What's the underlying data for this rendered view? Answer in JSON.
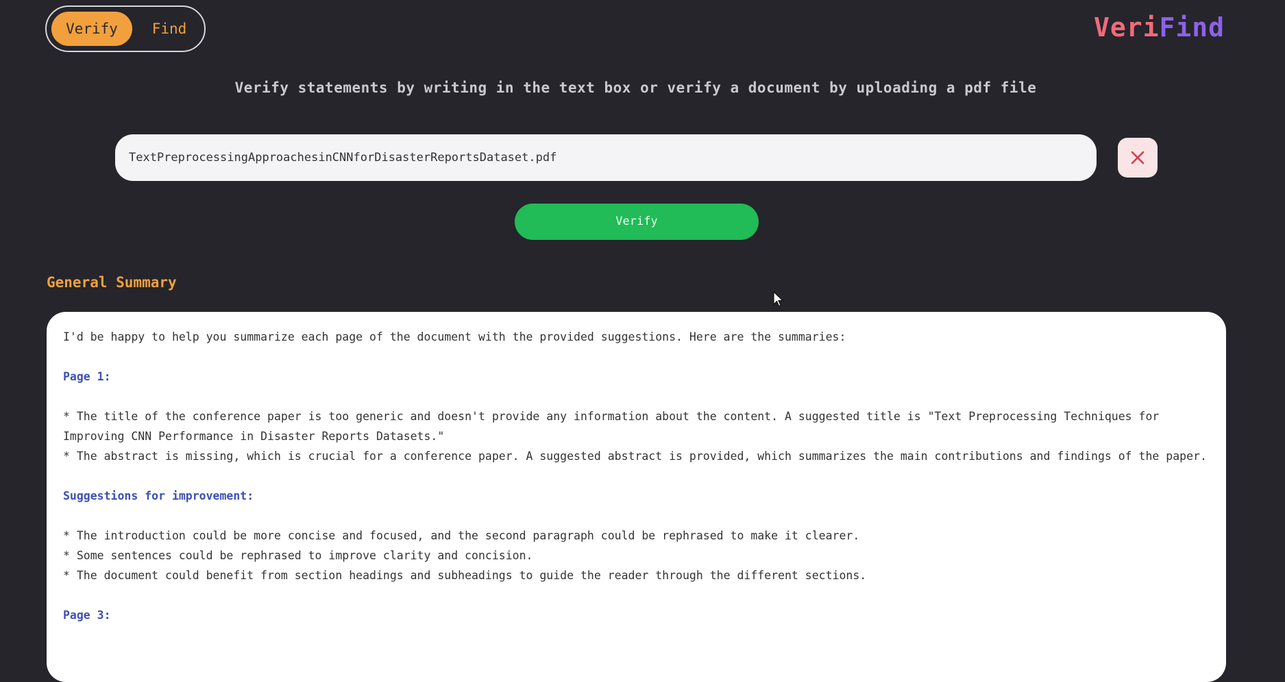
{
  "mode_toggle": {
    "verify_label": "Verify",
    "find_label": "Find",
    "active": "Verify"
  },
  "brand": {
    "part1": "Veri",
    "part2": "Find"
  },
  "instructions": "Verify statements by writing in the text box or verify a document by uploading a pdf file",
  "file_input": {
    "value": "TextPreprocessingApproachesinCNNforDisasterReportsDataset.pdf"
  },
  "icons": {
    "clear": "close-icon",
    "cursor": "mouse-pointer-icon"
  },
  "verify_button": "Verify",
  "section_title": "General Summary",
  "summary": {
    "intro": "I'd be happy to help you summarize each page of the document with the provided suggestions. Here are the summaries:",
    "page1_heading": "Page 1:",
    "page1_bullet1": "* The title of the conference paper is too generic and doesn't provide any information about the content. A suggested title is \"Text Preprocessing Techniques for Improving CNN Performance in Disaster Reports Datasets.\"",
    "page1_bullet2": "* The abstract is missing, which is crucial for a conference paper. A suggested abstract is provided, which summarizes the main contributions and findings of the paper.",
    "suggestions_heading": "Suggestions for improvement:",
    "suggestion1": "* The introduction could be more concise and focused, and the second paragraph could be rephrased to make it clearer.",
    "suggestion2": "* Some sentences could be rephrased to improve clarity and concision.",
    "suggestion3": "* The document could benefit from section headings and subheadings to guide the reader through the different sections.",
    "page3_heading": "Page 3:"
  },
  "colors": {
    "background": "#25252b",
    "accent_orange": "#f2a03d",
    "brand_pink": "#f06b7a",
    "brand_purple": "#8b63e8",
    "verify_green": "#21bb57",
    "heading_blue": "#3d4fb5"
  }
}
